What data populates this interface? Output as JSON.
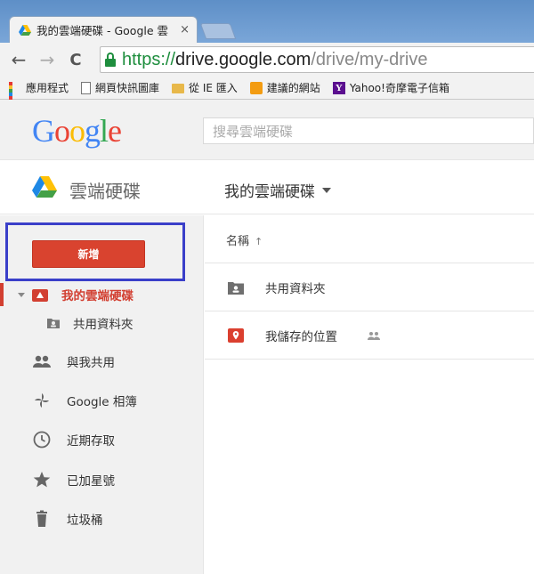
{
  "browser": {
    "tab_title": "我的雲端硬碟 - Google 雲",
    "tab_close": "×",
    "url_proto": "https://",
    "url_host": "drive.google.com",
    "url_path": "/drive/my-drive"
  },
  "bookmarks": [
    {
      "label": "應用程式",
      "icon": "apps-icon"
    },
    {
      "label": "網頁快訊圖庫",
      "icon": "page-icon"
    },
    {
      "label": "從 IE 匯入",
      "icon": "folder-icon"
    },
    {
      "label": "建議的網站",
      "icon": "suggested-sites-icon"
    },
    {
      "label": "Yahoo!奇摩電子信箱",
      "icon": "yahoo-icon"
    }
  ],
  "header": {
    "search_placeholder": "搜尋雲端硬碟",
    "app_name": "雲端硬碟",
    "breadcrumb": "我的雲端硬碟"
  },
  "sidebar": {
    "new_button": "新增",
    "my_drive": "我的雲端硬碟",
    "shared_folder": "共用資料夾",
    "items": [
      {
        "label": "與我共用",
        "icon": "people-icon"
      },
      {
        "label": "Google 相簿",
        "icon": "photos-icon"
      },
      {
        "label": "近期存取",
        "icon": "clock-icon"
      },
      {
        "label": "已加星號",
        "icon": "star-icon"
      },
      {
        "label": "垃圾桶",
        "icon": "trash-icon"
      }
    ]
  },
  "main": {
    "column_name": "名稱",
    "sort_arrow": "↑",
    "files": [
      {
        "name": "共用資料夾",
        "icon": "shared-folder-icon"
      },
      {
        "name": "我儲存的位置",
        "icon": "map-pin-icon"
      }
    ]
  },
  "colors": {
    "accent_red": "#d9432f",
    "highlight_blue": "#3a3fc9"
  }
}
